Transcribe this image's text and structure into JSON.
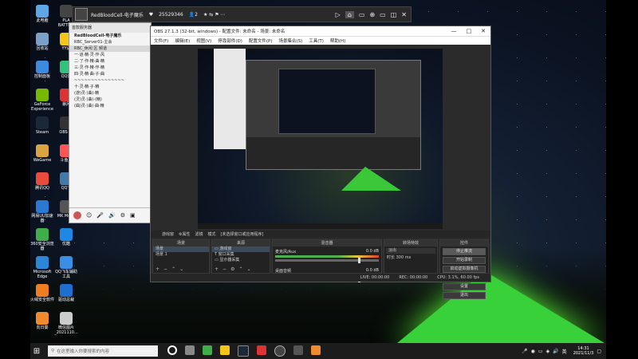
{
  "desktop_icons": [
    {
      "label": "此电脑",
      "color": "#5ea6e6"
    },
    {
      "label": "回收站",
      "color": "#7aa0c8"
    },
    {
      "label": "控制面板",
      "color": "#3d8be0"
    },
    {
      "label": "GeForce Experience",
      "color": "#76b900"
    },
    {
      "label": "Steam",
      "color": "#1b2838"
    },
    {
      "label": "WeGame",
      "color": "#d9a441"
    },
    {
      "label": "腾讯QQ",
      "color": "#e94b3c"
    },
    {
      "label": "网易UU加速器",
      "color": "#2a7ad3"
    },
    {
      "label": "360安全浏览器",
      "color": "#3fae49"
    },
    {
      "label": "Microsoft Edge",
      "color": "#2b88d8"
    },
    {
      "label": "火绒安全软件",
      "color": "#ef7d22"
    },
    {
      "label": "向日葵",
      "color": "#f08a2e"
    }
  ],
  "desktop_icons_col2": [
    {
      "label": "PLA BATTE...",
      "color": "#444"
    },
    {
      "label": "YY语",
      "color": "#f5c518"
    },
    {
      "label": "QQ音",
      "color": "#31c27c"
    },
    {
      "label": "暴风",
      "color": "#d33"
    },
    {
      "label": "OBS St",
      "color": "#333"
    },
    {
      "label": "斗鱼直",
      "color": "#f55"
    },
    {
      "label": "QQ飞",
      "color": "#47a"
    },
    {
      "label": "MK Mech",
      "color": "#555"
    },
    {
      "label": "优酷",
      "color": "#1e88e5"
    },
    {
      "label": "QQ飞车辅助工具",
      "color": "#3a8ee6"
    },
    {
      "label": "驱动总裁",
      "color": "#1f6fd1"
    },
    {
      "label": "微信图片_2021110...",
      "color": "#ccc"
    }
  ],
  "topbar": {
    "channel": "RedBloodCell-电子魔乐",
    "room_id": "25529346",
    "likes": "2",
    "icons": [
      "▷",
      "⌂",
      "▭",
      "⊕",
      "▭",
      "▭",
      "▭",
      "✕"
    ]
  },
  "chat": {
    "header": "首款服务器",
    "group": "RedBloodCell-电子魔乐",
    "rows": [
      "RBC_Server01-主会",
      "RBC_休闲 区 频道",
      "一·道·精·灵·作·风",
      "二·了·作·精·曲·精",
      "三·灵·作·精·作·精",
      "四·灵·精·曲·子·曲",
      "~~~~~~~~~~~~~~~",
      "十·灵·精·子·精",
      "(游)灵·(曲)·精",
      "(灵)灵·(曲)·(精)",
      "(曲)灵·(曲)·曲·精"
    ],
    "bottom_icons": [
      "☺",
      "🎤",
      "🔊",
      "⚙",
      "▣"
    ]
  },
  "obs": {
    "title": "OBS 27.1.3 (32-bit, windows) - 配置文件: 未命名 - 场景: 未命名",
    "menu": [
      "文件(F)",
      "编辑(E)",
      "视图(V)",
      "停靠部件(D)",
      "配置文件(P)",
      "场景集合(S)",
      "工具(T)",
      "帮助(H)"
    ],
    "source_bar": {
      "name": "游戏窗",
      "props": "⚙属性",
      "filters": "滤镜",
      "mode": "模式",
      "mode_value": "[未选择窗口或应用程序]"
    },
    "docks": {
      "scenes": {
        "title": "场景",
        "items": [
          "场景",
          "场景 1"
        ]
      },
      "sources": {
        "title": "来源",
        "items": [
          "游戏窗",
          "窗口采集",
          "显示器采集"
        ]
      },
      "mixer": {
        "title": "混音器",
        "channels": [
          {
            "name": "麦克风/Aux",
            "db": "0.0 dB"
          },
          {
            "name": "桌面音频",
            "db": "0.0 dB"
          }
        ]
      },
      "transitions": {
        "title": "转场特效",
        "type": "淡出",
        "duration_label": "时长",
        "duration": "300 ms"
      },
      "controls": {
        "title": "控件",
        "buttons": [
          "停止推流",
          "开始录制",
          "启动虚拟摄像机",
          "工作室模式",
          "设置",
          "退出"
        ]
      }
    },
    "status": {
      "live": "LIVE: 00:00:00",
      "rec": "REC: 00:00:00",
      "cpu": "CPU: 3.1%, 60.00 fps"
    }
  },
  "taskbar": {
    "search_placeholder": "在这里输入你要搜索的内容",
    "time": "14:31",
    "date": "2021/11/3"
  }
}
